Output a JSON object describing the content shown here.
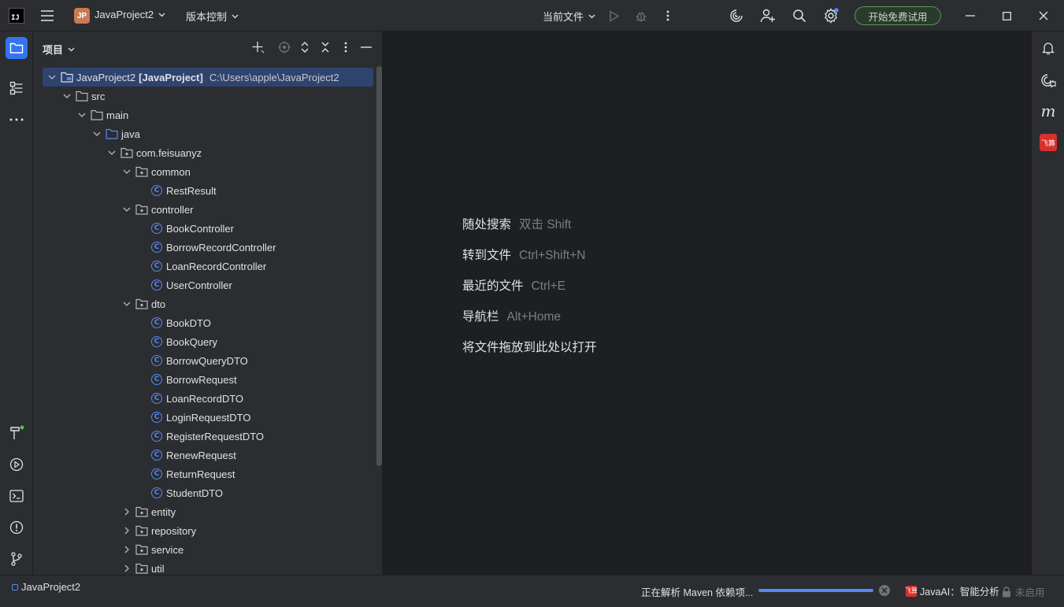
{
  "titlebar": {
    "app_logo": "IJ",
    "project_badge": "JP",
    "project_name": "JavaProject2",
    "vcs_label": "版本控制",
    "current_file_label": "当前文件",
    "trial_button": "开始免费试用",
    "icons": [
      "menu-icon",
      "run-icon",
      "debug-icon",
      "more-icon",
      "ai-assistant-icon",
      "add-user-icon",
      "search-icon",
      "settings-icon",
      "minimize-icon",
      "maximize-icon",
      "close-icon"
    ]
  },
  "panel": {
    "title": "项目",
    "tree": [
      {
        "depth": 0,
        "type": "module",
        "expanded": true,
        "label": "JavaProject2",
        "bold": "[JavaProject]",
        "path": "C:\\Users\\apple\\JavaProject2",
        "selected": true
      },
      {
        "depth": 1,
        "type": "folder",
        "expanded": true,
        "label": "src"
      },
      {
        "depth": 2,
        "type": "folder",
        "expanded": true,
        "label": "main"
      },
      {
        "depth": 3,
        "type": "source-folder",
        "expanded": true,
        "label": "java"
      },
      {
        "depth": 4,
        "type": "package",
        "expanded": true,
        "label": "com.feisuanyz"
      },
      {
        "depth": 5,
        "type": "package",
        "expanded": true,
        "label": "common"
      },
      {
        "depth": 6,
        "type": "class",
        "label": "RestResult"
      },
      {
        "depth": 5,
        "type": "package",
        "expanded": true,
        "label": "controller"
      },
      {
        "depth": 6,
        "type": "class",
        "label": "BookController"
      },
      {
        "depth": 6,
        "type": "class",
        "label": "BorrowRecordController"
      },
      {
        "depth": 6,
        "type": "class",
        "label": "LoanRecordController"
      },
      {
        "depth": 6,
        "type": "class",
        "label": "UserController"
      },
      {
        "depth": 5,
        "type": "package",
        "expanded": true,
        "label": "dto"
      },
      {
        "depth": 6,
        "type": "class",
        "label": "BookDTO"
      },
      {
        "depth": 6,
        "type": "class",
        "label": "BookQuery"
      },
      {
        "depth": 6,
        "type": "class",
        "label": "BorrowQueryDTO"
      },
      {
        "depth": 6,
        "type": "class",
        "label": "BorrowRequest"
      },
      {
        "depth": 6,
        "type": "class",
        "label": "LoanRecordDTO"
      },
      {
        "depth": 6,
        "type": "class",
        "label": "LoginRequestDTO"
      },
      {
        "depth": 6,
        "type": "class",
        "label": "RegisterRequestDTO"
      },
      {
        "depth": 6,
        "type": "class",
        "label": "RenewRequest"
      },
      {
        "depth": 6,
        "type": "class",
        "label": "ReturnRequest"
      },
      {
        "depth": 6,
        "type": "class",
        "label": "StudentDTO"
      },
      {
        "depth": 5,
        "type": "package",
        "expanded": false,
        "label": "entity"
      },
      {
        "depth": 5,
        "type": "package",
        "expanded": false,
        "label": "repository"
      },
      {
        "depth": 5,
        "type": "package",
        "expanded": false,
        "label": "service"
      },
      {
        "depth": 5,
        "type": "package",
        "expanded": false,
        "label": "util"
      }
    ]
  },
  "editor": {
    "hints": [
      {
        "label": "随处搜索",
        "key": "双击 Shift"
      },
      {
        "label": "转到文件",
        "key": "Ctrl+Shift+N"
      },
      {
        "label": "最近的文件",
        "key": "Ctrl+E"
      },
      {
        "label": "导航栏",
        "key": "Alt+Home"
      },
      {
        "label": "将文件拖放到此处以打开",
        "key": ""
      }
    ]
  },
  "right_strip": {
    "m_label": "m",
    "feisuan_label": "飞算"
  },
  "status": {
    "project": "JavaProject2",
    "task": "正在解析 Maven 依赖项...",
    "progress": 1.0,
    "ai_badge": "飞算",
    "ai_label": "JavaAI：智能分析",
    "lock_label": "未启用"
  },
  "colors": {
    "accent": "#3574f0",
    "selection": "#2e436e",
    "class_icon": "#548af7",
    "trial_border": "#57965c"
  }
}
